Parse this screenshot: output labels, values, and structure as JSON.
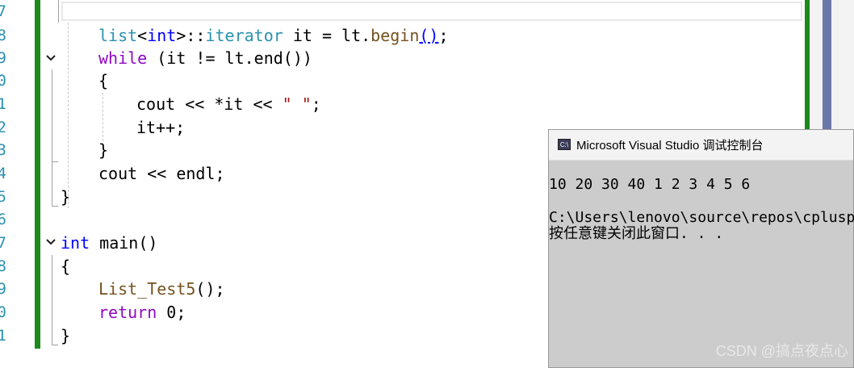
{
  "editor": {
    "line_numbers": [
      "7",
      "8",
      "9",
      "0",
      "1",
      "2",
      "3",
      "4",
      "5",
      "6",
      "7",
      "8",
      "9",
      "0",
      "1"
    ],
    "lines": {
      "l8": {
        "a": "list",
        "b": "<",
        "c": "int",
        "d": ">::",
        "e": "iterator",
        "f": " it = lt.",
        "g": "begin",
        "h": "()",
        "i": ";"
      },
      "l9": {
        "a": "while",
        "b": " (it != lt.end())"
      },
      "l10": {
        "a": "{"
      },
      "l11": {
        "a": "cout << *it << ",
        "b": "\" \"",
        "c": ";"
      },
      "l12": {
        "a": "it++;"
      },
      "l13": {
        "a": "}"
      },
      "l14": {
        "a": "cout << endl;"
      },
      "l15": {
        "a": "}"
      },
      "l17": {
        "a": "int",
        "b": " main()"
      },
      "l18": {
        "a": "{"
      },
      "l19": {
        "a": "List_Test5",
        "b": "();"
      },
      "l20": {
        "a": "return",
        "b": " 0;"
      },
      "l21": {
        "a": "}"
      }
    }
  },
  "console": {
    "title": "Microsoft Visual Studio 调试控制台",
    "icon_label": "C:\\",
    "output_line": "10 20 30 40 1 2 3 4 5 6",
    "path_line": "C:\\Users\\lenovo\\source\\repos\\cplusplus",
    "prompt_line": "按任意键关闭此窗口. . ."
  },
  "watermark": "CSDN @搞点夜点心",
  "colors": {
    "change_bar": "#1c8a1c",
    "keyword": "#8f08c4",
    "type_keyword": "#0000ff",
    "type_name": "#2b91af",
    "string": "#a31515",
    "console_bg": "#cccccc"
  }
}
